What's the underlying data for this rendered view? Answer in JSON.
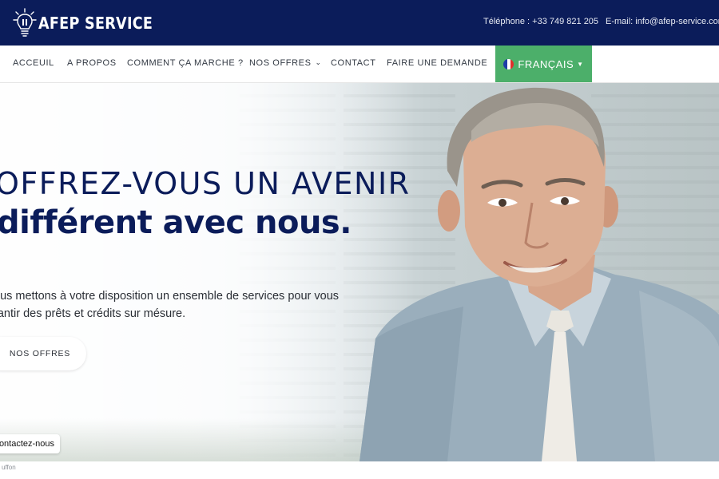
{
  "header": {
    "logo_text": "AFEP SERVICE",
    "phone": "Téléphone : +33 749 821 205",
    "email": "E-mail: info@afep-service.com",
    "background_color": "#0b1c5a"
  },
  "nav": {
    "items": [
      {
        "label": "ACCEUIL"
      },
      {
        "label": "A PROPOS"
      },
      {
        "label": "COMMENT ÇA MARCHE ?"
      },
      {
        "label": "NOS OFFRES",
        "has_dropdown": true
      },
      {
        "label": "CONTACT"
      },
      {
        "label": "FAIRE UNE DEMANDE"
      }
    ],
    "language": {
      "label": "FRANÇAIS",
      "flag_icon": "france-flag-icon",
      "color": "#4caf6a"
    }
  },
  "hero": {
    "title_line_1": "OFFREZ-VOUS UN AVENIR",
    "title_line_2": "différent avec nous.",
    "subtitle_line_1": "ous mettons à votre disposition un ensemble de services pour vous",
    "subtitle_line_2": "rantir des prêts et crédits sur mésure.",
    "offers_button": "NOS OFFRES",
    "contact_button": "ontactez-nous",
    "title_color": "#0b1c5a"
  },
  "footer": {
    "label": "uffon"
  }
}
